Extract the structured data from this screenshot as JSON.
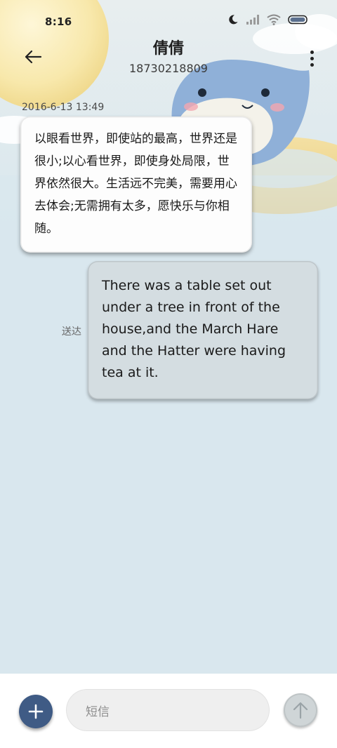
{
  "status_bar": {
    "time": "8:16",
    "icons": [
      "moon-icon",
      "signal-icon",
      "wifi-icon",
      "battery-icon"
    ]
  },
  "header": {
    "contact_name": "倩倩",
    "contact_number": "18730218809",
    "back_icon": "back-arrow-icon",
    "more_icon": "more-vertical-icon"
  },
  "conversation": {
    "timestamp": "2016-6-13 13:49",
    "incoming_message": "以眼看世界，即使站的最高，世界还是很小;以心看世界，即使身处局限，世界依然很大。生活远不完美，需要用心去体会;无需拥有太多，愿快乐与你相随。",
    "outgoing_message": "There was a table set out under a tree in front of the house,and the March Hare and the Hatter were having tea at it.",
    "delivered_status": "送达"
  },
  "composer": {
    "add_icon": "plus-icon",
    "input_placeholder": "短信",
    "send_icon": "send-arrow-up-icon"
  },
  "colors": {
    "background": "#d9e7ee",
    "incoming_bubble": "#fdfdfd",
    "outgoing_bubble": "#d4dde1",
    "add_button": "#3f5b85",
    "send_button": "#cfd5d7"
  }
}
